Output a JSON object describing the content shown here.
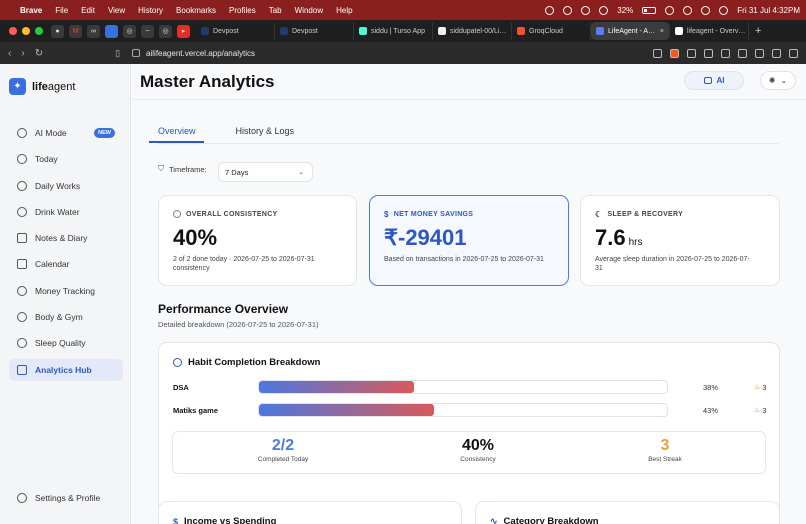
{
  "menubar": {
    "app": "Brave",
    "items": [
      "File",
      "Edit",
      "View",
      "History",
      "Bookmarks",
      "Profiles",
      "Tab",
      "Window",
      "Help"
    ],
    "battery": "32%",
    "battery_level": 0.32,
    "datetime": "Fri 31 Jul  4:32PM"
  },
  "tabbar": {
    "tabs": [
      {
        "label": "Devpost",
        "icon": "devpost-icon"
      },
      {
        "label": "Devpost",
        "icon": "devpost-icon"
      },
      {
        "label": "siddu | Turso App",
        "icon": "turso-icon"
      },
      {
        "label": "siddupatel-00/Li…",
        "icon": "github-icon"
      },
      {
        "label": "GroqCloud",
        "icon": "groq-icon"
      },
      {
        "label": "LifeAgent - A…",
        "icon": "lifeagent-icon",
        "active": true
      },
      {
        "label": "lifeagent - Overv…",
        "icon": "vercel-icon"
      }
    ]
  },
  "address": {
    "url": "ailifeagent.vercel.app/analytics"
  },
  "sidebar": {
    "logo_strong": "life",
    "logo_rest": "agent",
    "items": [
      {
        "label": "AI Mode",
        "badge": "NEW",
        "icon": "sparkle-icon"
      },
      {
        "label": "Today",
        "icon": "clock-icon"
      },
      {
        "label": "Daily Works",
        "icon": "check-circle-icon"
      },
      {
        "label": "Drink Water",
        "icon": "droplet-icon"
      },
      {
        "label": "Notes & Diary",
        "icon": "book-icon"
      },
      {
        "label": "Calendar",
        "icon": "calendar-icon"
      },
      {
        "label": "Money Tracking",
        "icon": "dollar-icon"
      },
      {
        "label": "Body & Gym",
        "icon": "dumbbell-icon"
      },
      {
        "label": "Sleep Quality",
        "icon": "moon-icon"
      },
      {
        "label": "Analytics Hub",
        "icon": "bar-chart-icon",
        "active": true
      }
    ],
    "settings": "Settings & Profile"
  },
  "main": {
    "title": "Master Analytics",
    "ai_label": "AI",
    "tabs": [
      "Overview",
      "History & Logs"
    ],
    "timeframe_label": "Timeframe:",
    "timeframe_value": "7 Days",
    "cards": [
      {
        "label": "OVERALL CONSISTENCY",
        "value": "40%",
        "unit": "",
        "desc": "2 of 2 done today · 2026-07-25 to 2026-07-31 consistency"
      },
      {
        "label": "NET MONEY SAVINGS",
        "value": "₹-29401",
        "unit": "",
        "desc": "Based on transactions in 2026-07-25 to 2026-07-31"
      },
      {
        "label": "SLEEP & RECOVERY",
        "value": "7.6",
        "unit": "hrs",
        "desc": "Average sleep duration in 2026-07-25 to 2026-07-31"
      }
    ],
    "perf_title": "Performance Overview",
    "perf_sub": "Detailed breakdown (2026-07-25 to 2026-07-31)",
    "habit_title": "Habit Completion Breakdown",
    "habits": [
      {
        "name": "DSA",
        "pct": "38%",
        "level": 0.38,
        "streak": "3"
      },
      {
        "name": "Matiks game",
        "pct": "43%",
        "level": 0.43,
        "streak": "3"
      }
    ],
    "stats": [
      {
        "value": "2/2",
        "label": "Completed Today",
        "color": "#4a7be2"
      },
      {
        "value": "40%",
        "label": "Consistency",
        "color": "#111111"
      },
      {
        "value": "3",
        "label": "Best Streak",
        "color": "#e8a23a"
      }
    ],
    "bottom": [
      {
        "title": "Income vs Spending",
        "icon": "dollar-icon"
      },
      {
        "title": "Category Breakdown",
        "icon": "activity-icon"
      }
    ]
  }
}
